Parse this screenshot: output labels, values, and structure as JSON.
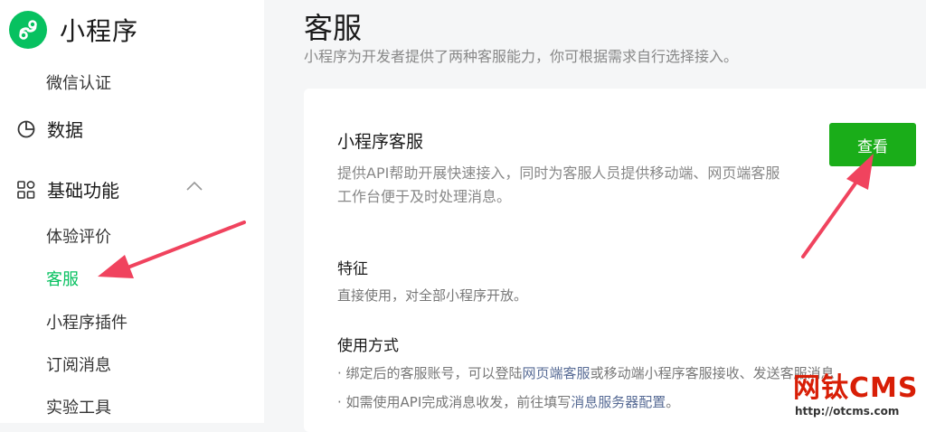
{
  "app": {
    "name": "小程序"
  },
  "sidebar": {
    "items": [
      {
        "label": "微信认证"
      },
      {
        "label": "数据"
      },
      {
        "label": "基础功能"
      },
      {
        "label": "体验评价"
      },
      {
        "label": "客服"
      },
      {
        "label": "小程序插件"
      },
      {
        "label": "订阅消息"
      },
      {
        "label": "实验工具"
      }
    ],
    "active": "客服"
  },
  "page": {
    "title": "客服",
    "description": "小程序为开发者提供了两种客服能力，你可根据需求自行选择接入。"
  },
  "card": {
    "title": "小程序客服",
    "description": "提供API帮助开展快速接入，同时为客服人员提供移动端、网页端客服工作台便于及时处理消息。",
    "button_label": "查看",
    "features_title": "特征",
    "features_text": "直接使用，对全部小程序开放。",
    "usage_title": "使用方式",
    "usage_line1": {
      "prefix": "· 绑定后的客服账号，可以登陆",
      "link": "网页端客服",
      "suffix": "或移动端小程序客服接收、发送客服消息"
    },
    "usage_line2": {
      "prefix": "· 如需使用API完成消息收发，前往填写",
      "link": "消息服务器配置",
      "suffix": "。"
    }
  },
  "watermark": {
    "text": "网钛CMS",
    "url": "http://otcms.com"
  },
  "colors": {
    "brand": "#07c160",
    "button": "#1aad19",
    "link": "#576b95",
    "arrow": "#f0435e",
    "watermark": "#d81e06"
  },
  "icons": {
    "logo": "mini-program-logo-icon",
    "data": "pie-chart-icon",
    "basic": "grid-icon",
    "collapse": "chevron-up-icon"
  }
}
